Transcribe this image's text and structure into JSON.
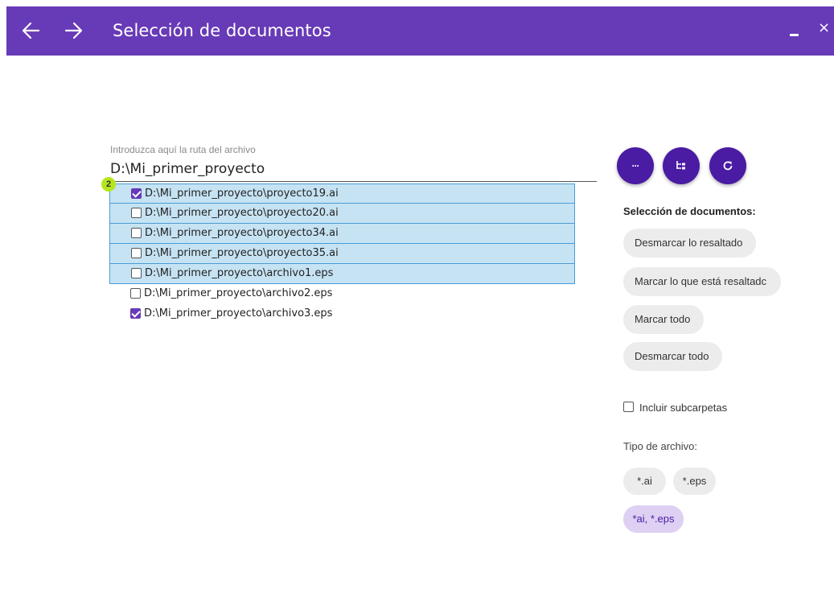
{
  "titlebar": {
    "title": "Selección de documentos",
    "back_icon": "arrow-left-icon",
    "forward_icon": "arrow-right-icon",
    "close_glyph": "×",
    "background": "#673ab7"
  },
  "path": {
    "label": "Introduzca aquí la ruta del archivo",
    "value": "D:\\Mi_primer_proyecto"
  },
  "badge": "2",
  "files": [
    {
      "name": "D:\\Mi_primer_proyecto\\proyecto19.ai",
      "checked": true,
      "highlighted": true
    },
    {
      "name": "D:\\Mi_primer_proyecto\\proyecto20.ai",
      "checked": false,
      "highlighted": true
    },
    {
      "name": "D:\\Mi_primer_proyecto\\proyecto34.ai",
      "checked": false,
      "highlighted": true
    },
    {
      "name": "D:\\Mi_primer_proyecto\\proyecto35.ai",
      "checked": false,
      "highlighted": true
    },
    {
      "name": "D:\\Mi_primer_proyecto\\archivo1.eps",
      "checked": false,
      "highlighted": true
    },
    {
      "name": "D:\\Mi_primer_proyecto\\archivo2.eps",
      "checked": false,
      "highlighted": false
    },
    {
      "name": "D:\\Mi_primer_proyecto\\archivo3.eps",
      "checked": true,
      "highlighted": false
    }
  ],
  "actions": {
    "browse_glyph": "···",
    "browse_icon": "more-horizontal-icon",
    "tree_icon": "folder-tree-icon",
    "refresh_icon": "refresh-icon",
    "accent": "#4a1ba3"
  },
  "selection": {
    "title": "Selección de documentos:",
    "unmark_highlighted": "Desmarcar lo resaltado",
    "mark_highlighted": "Marcar lo que está resaltadc",
    "mark_all": "Marcar todo",
    "unmark_all": "Desmarcar todo"
  },
  "include_subfolders": {
    "label": "Incluir subcarpetas",
    "checked": false
  },
  "file_type": {
    "label": "Tipo de archivo:",
    "options": [
      "*.ai",
      "*.eps",
      "*ai, *.eps"
    ],
    "selected": "*ai, *.eps"
  }
}
